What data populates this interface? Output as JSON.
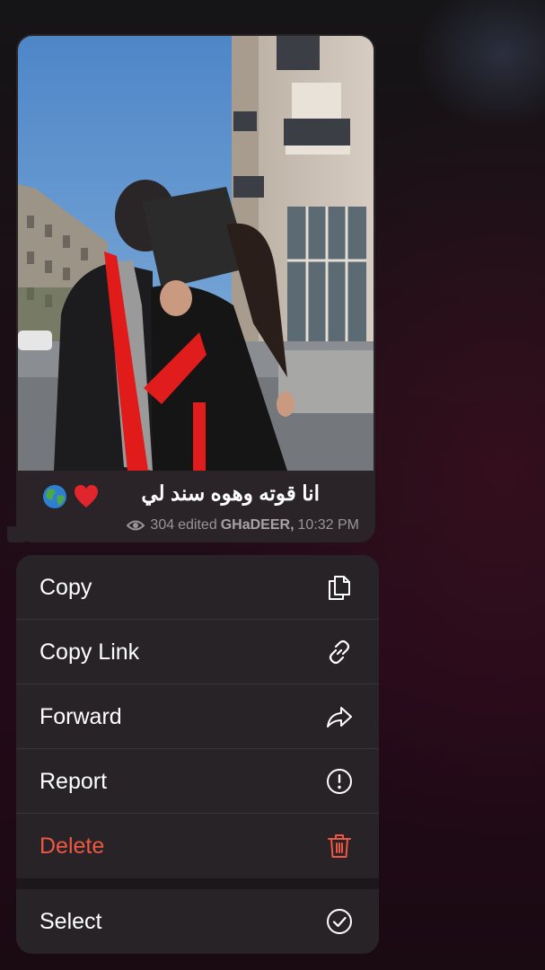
{
  "message": {
    "caption": "انا قوته وهوه سند لي",
    "caption_emojis": [
      "heart",
      "globe"
    ],
    "views": "304",
    "edited_label": "edited",
    "sender": "GHaDEER,",
    "time": "10:32 PM"
  },
  "menu": {
    "items": [
      {
        "label": "Copy",
        "icon": "copy-icon"
      },
      {
        "label": "Copy Link",
        "icon": "link-icon"
      },
      {
        "label": "Forward",
        "icon": "forward-icon"
      },
      {
        "label": "Report",
        "icon": "report-icon"
      },
      {
        "label": "Delete",
        "icon": "trash-icon"
      },
      {
        "label": "Select",
        "icon": "check-circle-icon"
      }
    ]
  },
  "colors": {
    "menu_background": "#282326",
    "destructive": "#ef5744",
    "bubble": "#2a2327"
  }
}
